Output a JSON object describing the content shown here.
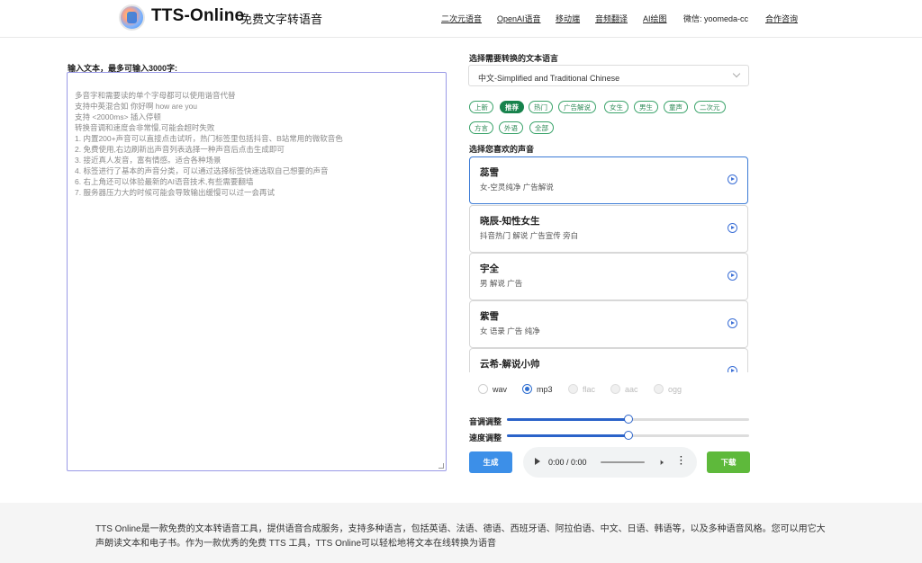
{
  "header": {
    "brand": "TTS-Online",
    "subtitle": "免费文字转语音",
    "nav": [
      "二次元语音",
      "OpenAI语音",
      "移动端",
      "音频翻译",
      "AI绘图",
      "微信: yoomeda-cc",
      "合作咨询"
    ]
  },
  "input": {
    "label": "输入文本，最多可输入3000字:",
    "placeholder_lines": [
      "多音字和需要读的单个字母都可以使用谐音代替",
      "支持中英混合如 你好啊 how are you",
      "支持 <2000ms> 插入停顿",
      "转换音调和速度会非常慢,可能会超时失败",
      "1. 内置200+声音可以直接点击试听，热门标签里包括抖音、B站常用的微软音色",
      "2. 免费使用,右边刷新出声音列表选择一种声音后点击生成即可",
      "3. 接近真人发音，富有情感。适合各种场景",
      "4. 标签进行了基本的声音分类，可以通过选择标签快速选取自己想要的声音",
      "6. 右上角还可以体验最新的AI语音技术,有些需要翻墙",
      "7. 服务器压力大的时候可能会导致输出缓慢可以过一会再试"
    ]
  },
  "language": {
    "label": "选择需要转换的文本语言",
    "selected": "中文-Simplified and Traditional Chinese"
  },
  "tags": [
    "上新",
    "推荐",
    "热门",
    "广告解说",
    "女生",
    "男生",
    "童声",
    "二次元",
    "方言",
    "外语",
    "全部"
  ],
  "active_tag": "推荐",
  "voices": {
    "label": "选择您喜欢的声音",
    "items": [
      {
        "name": "蕊雪",
        "desc": "女-空灵纯净 广告解说"
      },
      {
        "name": "晓辰-知性女生",
        "desc": "抖音热门 解说 广告宣传 旁白"
      },
      {
        "name": "宇全",
        "desc": "男 解说 广告"
      },
      {
        "name": "紫雪",
        "desc": "女 语录 广告 纯净"
      },
      {
        "name": "云希-解说小帅",
        "desc": ""
      }
    ]
  },
  "formats": [
    {
      "label": "wav",
      "checked": false,
      "disabled": false
    },
    {
      "label": "mp3",
      "checked": true,
      "disabled": false
    },
    {
      "label": "flac",
      "checked": false,
      "disabled": true
    },
    {
      "label": "aac",
      "checked": false,
      "disabled": true
    },
    {
      "label": "ogg",
      "checked": false,
      "disabled": true
    }
  ],
  "sliders": {
    "pitch_label": "音调调整",
    "pitch_value": 0.5,
    "speed_label": "速度调整",
    "speed_value": 0.5
  },
  "actions": {
    "generate": "生成",
    "download": "下载",
    "audio_time": "0:00 / 0:00"
  },
  "footer": {
    "text": "TTS Online是一款免费的文本转语音工具，提供语音合成服务，支持多种语言，包括英语、法语、德语、西班牙语、阿拉伯语、中文、日语、韩语等，以及多种语音风格。您可以用它大声朗读文本和电子书。作为一款优秀的免费 TTS 工具，TTS Online可以轻松地将文本在线转换为语音"
  }
}
